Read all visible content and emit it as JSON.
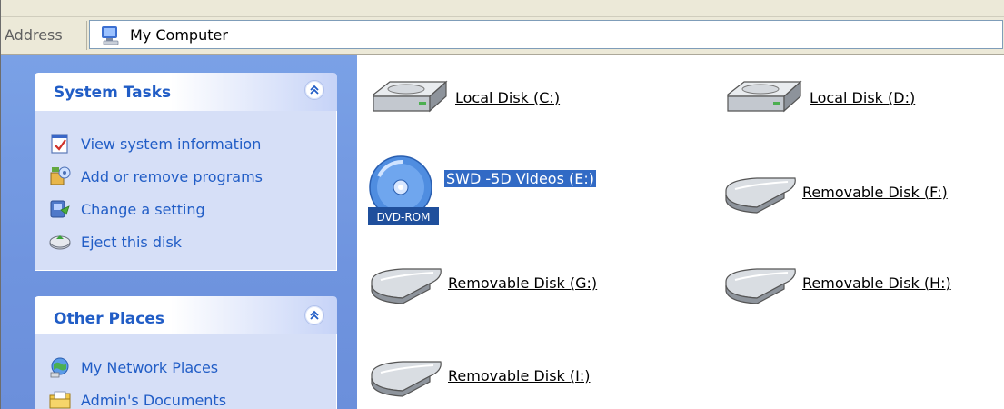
{
  "address_bar": {
    "label": "Address",
    "value": "My Computer",
    "icon": "my-computer-icon"
  },
  "task_panels": [
    {
      "title": "System Tasks",
      "items": [
        {
          "label": "View system information",
          "icon": "system-info-icon"
        },
        {
          "label": "Add or remove programs",
          "icon": "add-remove-programs-icon"
        },
        {
          "label": "Change a setting",
          "icon": "control-panel-icon"
        },
        {
          "label": "Eject this disk",
          "icon": "eject-disk-icon"
        }
      ]
    },
    {
      "title": "Other Places",
      "items": [
        {
          "label": "My Network Places",
          "icon": "network-places-icon"
        },
        {
          "label": "Admin's Documents",
          "icon": "documents-folder-icon"
        }
      ]
    }
  ],
  "drives": [
    {
      "label": "Local Disk (C:)",
      "icon": "hard-disk-icon"
    },
    {
      "label": "Local Disk (D:)",
      "icon": "hard-disk-icon"
    },
    {
      "label": "SWD -5D Videos (E:)",
      "icon": "dvd-rom-icon",
      "selected": true,
      "badge": "DVD-ROM"
    },
    {
      "label": "Removable Disk (F:)",
      "icon": "removable-disk-icon"
    },
    {
      "label": "Removable Disk (G:)",
      "icon": "removable-disk-icon"
    },
    {
      "label": "Removable Disk (H:)",
      "icon": "removable-disk-icon"
    },
    {
      "label": "Removable Disk (I:)",
      "icon": "removable-disk-icon"
    }
  ],
  "colors": {
    "task_pane_bg": "#7aa1e6",
    "panel_title": "#215dc6",
    "selection": "#316ac5"
  }
}
